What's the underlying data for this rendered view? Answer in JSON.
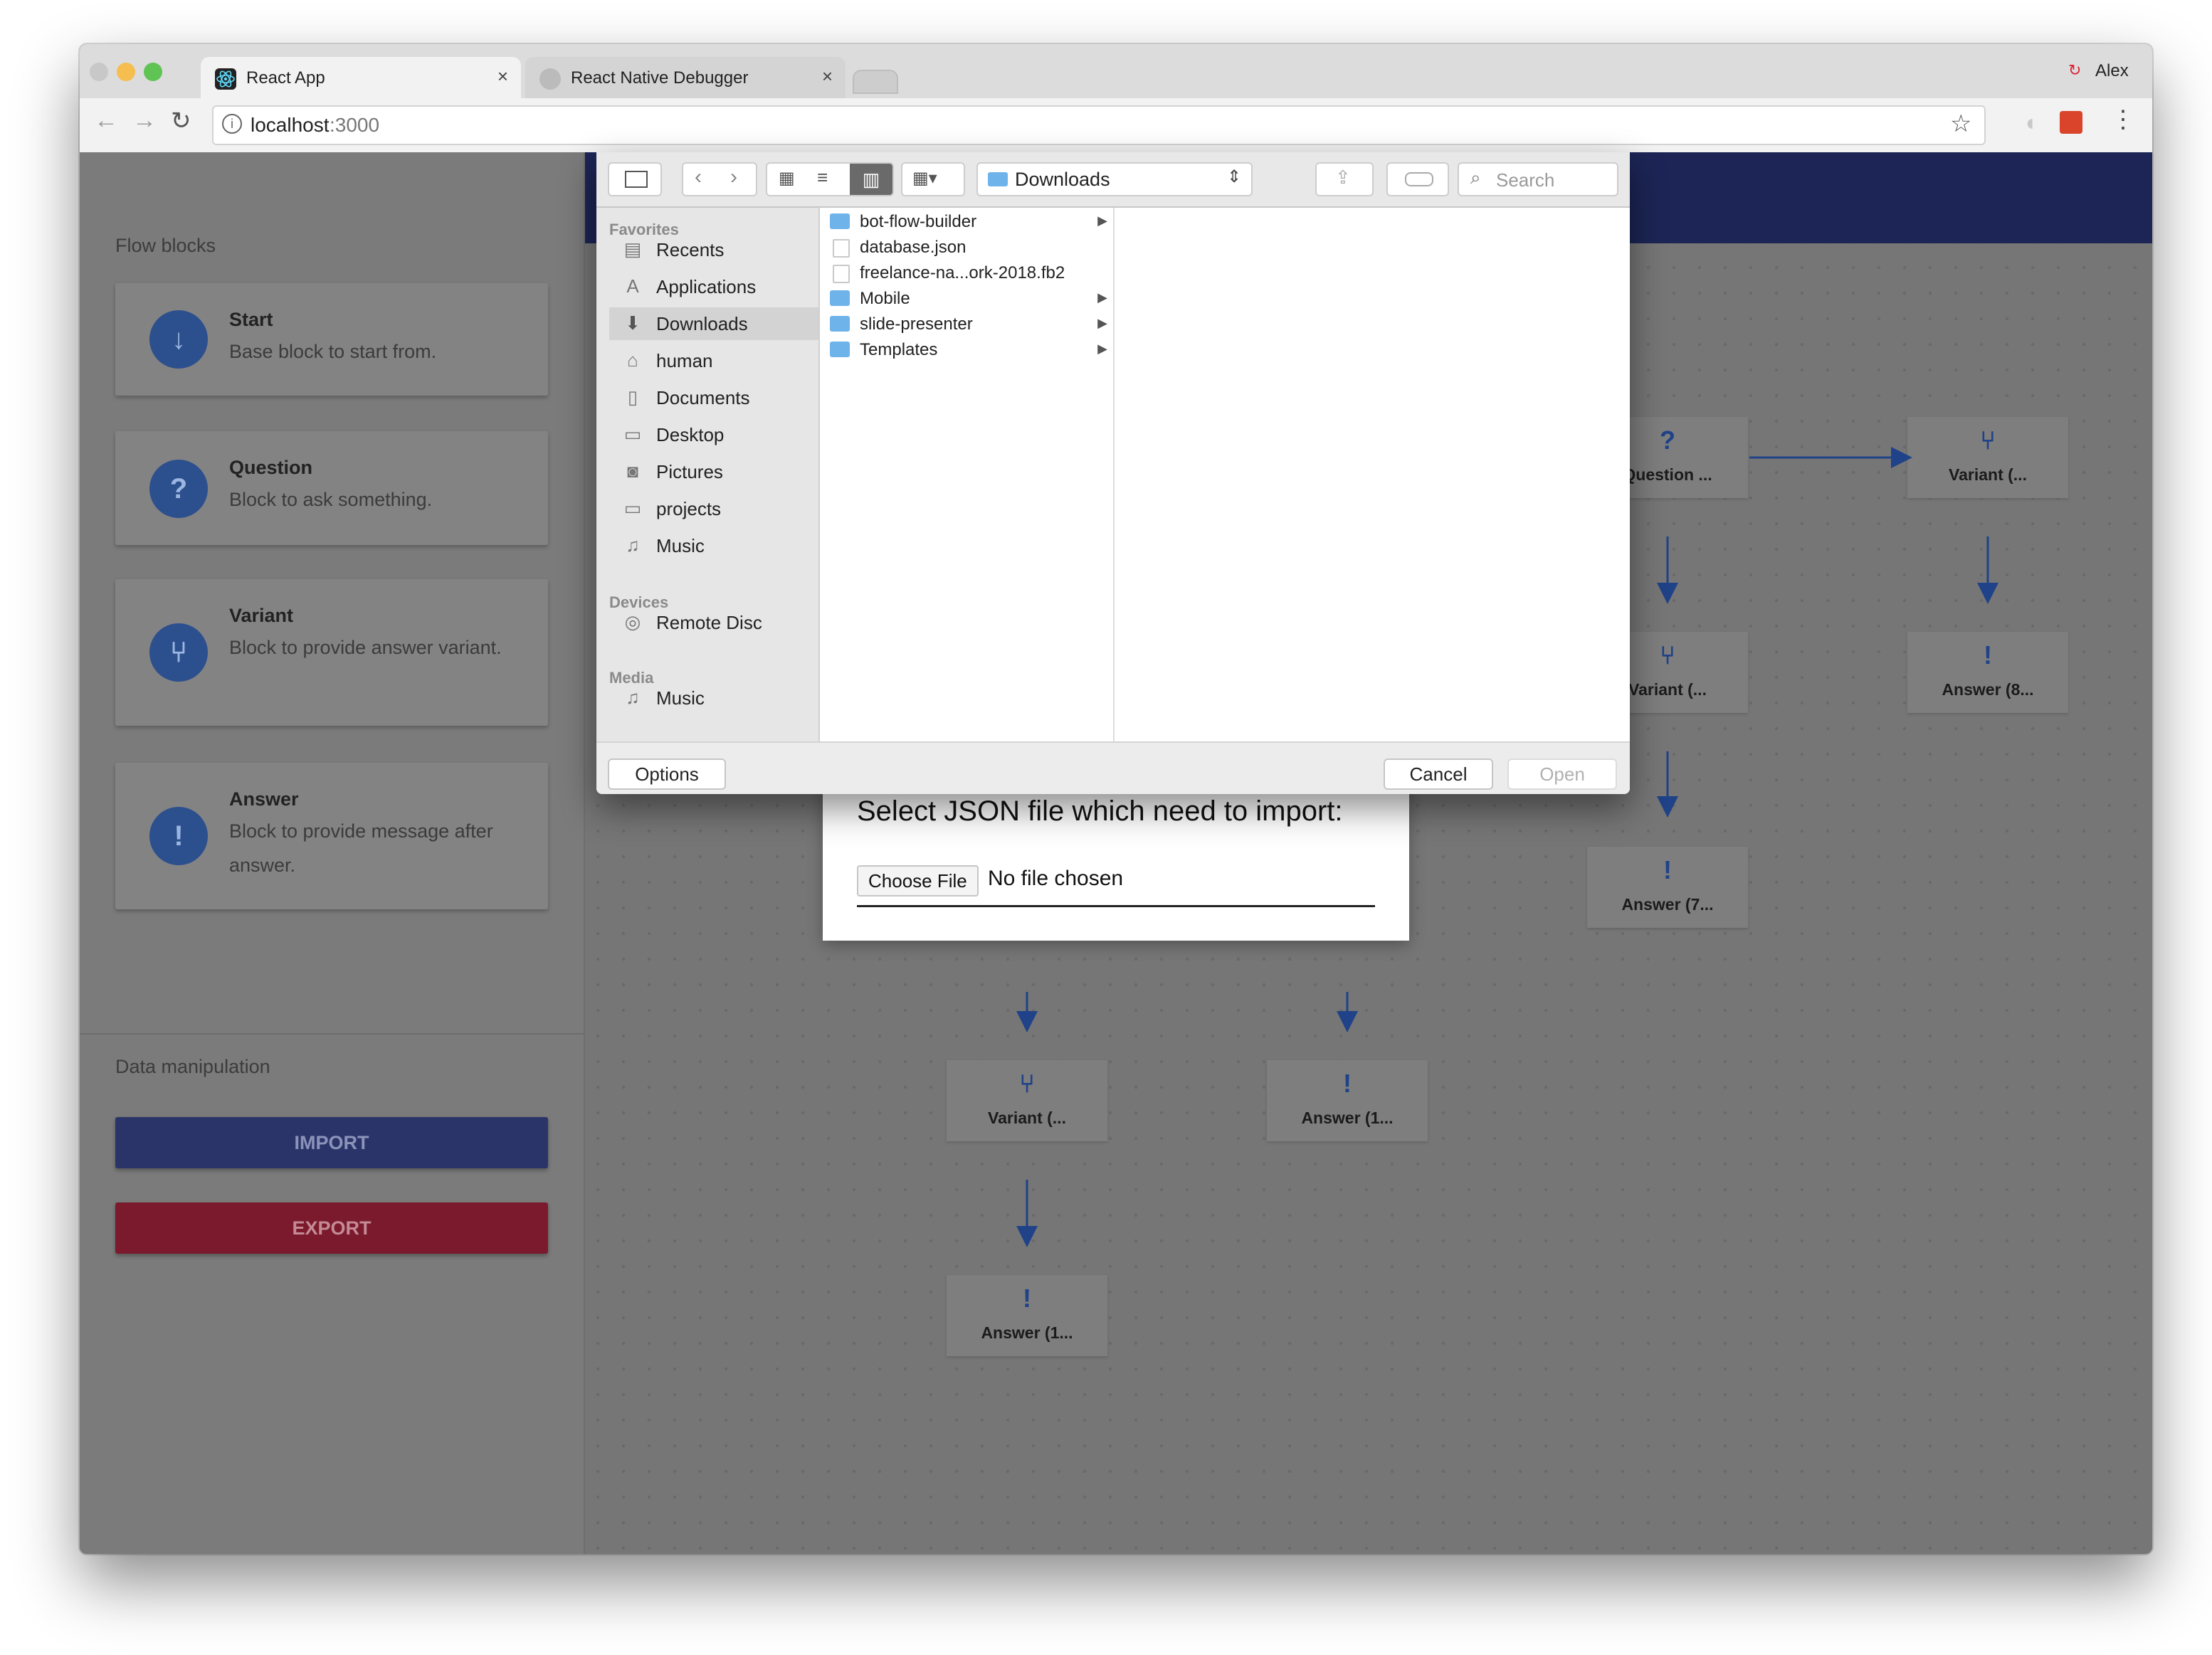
{
  "browser": {
    "tabs": [
      {
        "title": "React App",
        "close": "×"
      },
      {
        "title": "React Native Debugger",
        "close": "×"
      }
    ],
    "profile_name": "Alex",
    "url_host": "localhost",
    "url_port": ":3000"
  },
  "sidebar": {
    "flow_blocks_title": "Flow blocks",
    "blocks": [
      {
        "title": "Start",
        "description": "Base block to start from.",
        "icon": "download-arrow-icon",
        "glyph": "↓"
      },
      {
        "title": "Question",
        "description": "Block to ask something.",
        "icon": "question-mark-icon",
        "glyph": "?"
      },
      {
        "title": "Variant",
        "description": "Block to provide answer variant.",
        "icon": "split-arrow-icon",
        "glyph": "⑂"
      },
      {
        "title": "Answer",
        "description": "Block to provide message after answer.",
        "icon": "exclamation-icon",
        "glyph": "!"
      }
    ],
    "data_title": "Data manipulation",
    "import_label": "IMPORT",
    "export_label": "EXPORT"
  },
  "canvas": {
    "nodes": [
      {
        "label": "Question ...",
        "glyph": "?"
      },
      {
        "label": "Variant (...",
        "glyph": "⑂"
      },
      {
        "label": "Variant (...",
        "glyph": "⑂"
      },
      {
        "label": "Answer (8...",
        "glyph": "!"
      },
      {
        "label": "Answer (7...",
        "glyph": "!"
      },
      {
        "label": "Variant (...",
        "glyph": "⑂"
      },
      {
        "label": "Answer (1...",
        "glyph": "!"
      },
      {
        "label": "Answer (1...",
        "glyph": "!"
      }
    ]
  },
  "import_modal": {
    "title": "Select JSON file which need to import:",
    "choose_file_label": "Choose File",
    "file_status": "No file chosen"
  },
  "file_dialog": {
    "location": "Downloads",
    "search_placeholder": "Search",
    "sidebar_sections": [
      {
        "heading": "Favorites",
        "items": [
          {
            "label": "Recents",
            "icon": "recents-icon",
            "glyph": "▤"
          },
          {
            "label": "Applications",
            "icon": "applications-icon",
            "glyph": "A"
          },
          {
            "label": "Downloads",
            "icon": "downloads-icon",
            "glyph": "⬇"
          },
          {
            "label": "human",
            "icon": "home-icon",
            "glyph": "⌂"
          },
          {
            "label": "Documents",
            "icon": "documents-icon",
            "glyph": "▯"
          },
          {
            "label": "Desktop",
            "icon": "desktop-icon",
            "glyph": "▭"
          },
          {
            "label": "Pictures",
            "icon": "pictures-icon",
            "glyph": "◙"
          },
          {
            "label": "projects",
            "icon": "folder-icon",
            "glyph": "▭"
          },
          {
            "label": "Music",
            "icon": "music-icon",
            "glyph": "♫"
          }
        ]
      },
      {
        "heading": "Devices",
        "items": [
          {
            "label": "Remote Disc",
            "icon": "disc-icon",
            "glyph": "◎"
          }
        ]
      },
      {
        "heading": "Media",
        "items": [
          {
            "label": "Music",
            "icon": "music-icon",
            "glyph": "♫"
          }
        ]
      }
    ],
    "files": [
      {
        "name": "bot-flow-builder",
        "type": "folder"
      },
      {
        "name": "database.json",
        "type": "file"
      },
      {
        "name": "freelance-na...ork-2018.fb2",
        "type": "file"
      },
      {
        "name": "Mobile",
        "type": "folder"
      },
      {
        "name": "slide-presenter",
        "type": "folder"
      },
      {
        "name": "Templates",
        "type": "folder"
      }
    ],
    "options_label": "Options",
    "cancel_label": "Cancel",
    "open_label": "Open"
  },
  "colors": {
    "app_bar": "#1c2555",
    "import_button": "#2a3468",
    "export_button": "#7a1a2c",
    "node_icon": "#1f4288",
    "folder": "#6eb3ea"
  }
}
